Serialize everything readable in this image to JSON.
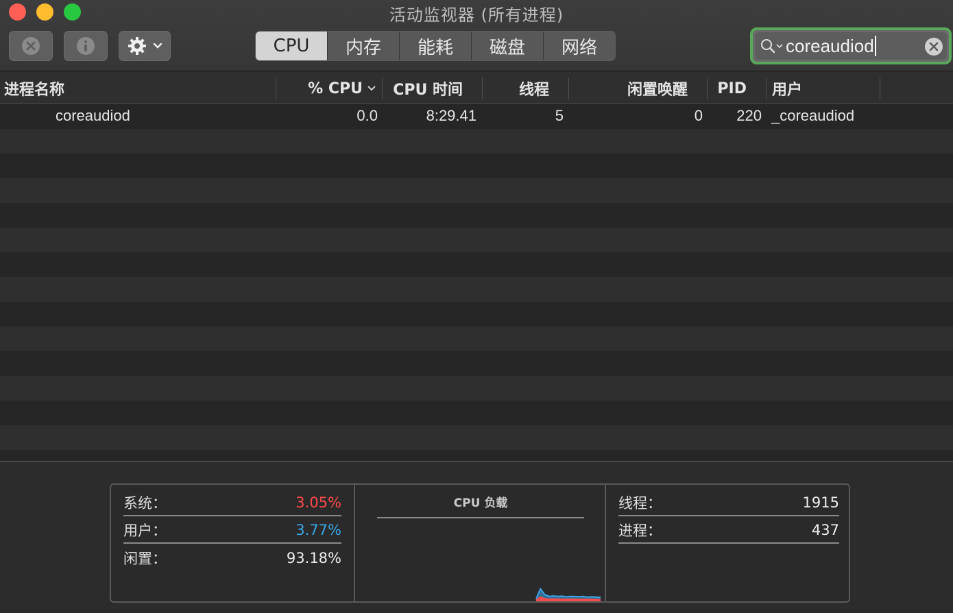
{
  "window": {
    "title": "活动监视器 (所有进程)"
  },
  "toolbar": {
    "tabs": [
      {
        "label": "CPU",
        "active": true
      },
      {
        "label": "内存",
        "active": false
      },
      {
        "label": "能耗",
        "active": false
      },
      {
        "label": "磁盘",
        "active": false
      },
      {
        "label": "网络",
        "active": false
      }
    ],
    "search": {
      "value": "coreaudiod"
    },
    "icons": [
      "stop-process-icon",
      "info-icon",
      "gear-icon",
      "search-icon",
      "clear-icon"
    ]
  },
  "table": {
    "columns": [
      "进程名称",
      "% CPU",
      "CPU 时间",
      "线程",
      "闲置唤醒",
      "PID",
      "用户"
    ],
    "rows": [
      {
        "name": "coreaudiod",
        "cpu": "0.0",
        "cpu_time": "8:29.41",
        "threads": "5",
        "idle_wake": "0",
        "pid": "220",
        "user": "_coreaudiod"
      }
    ]
  },
  "summary": {
    "system": {
      "label": "系统：",
      "value": "3.05%"
    },
    "user": {
      "label": "用户：",
      "value": "3.77%"
    },
    "idle": {
      "label": "闲置：",
      "value": "93.18%"
    },
    "threads": {
      "label": "线程：",
      "value": "1915"
    },
    "processes": {
      "label": "进程：",
      "value": "437"
    }
  },
  "colors": {
    "system": "#ff4a4a",
    "user": "#3aa6ea",
    "search_focus": "#59a85a"
  },
  "chart_data": {
    "type": "area",
    "title": "CPU 负载",
    "x": [
      0,
      1,
      2,
      3,
      4,
      5,
      6,
      7,
      8,
      9,
      10,
      11,
      12,
      13,
      14,
      15
    ],
    "series": [
      {
        "values": [
          0.03,
          0.15,
          0.08,
          0.06,
          0.065,
          0.06,
          0.062,
          0.055,
          0.06,
          0.058,
          0.055,
          0.06,
          0.05,
          0.055,
          0.05,
          0.048
        ]
      },
      {
        "values": [
          0.015,
          0.05,
          0.03,
          0.025,
          0.028,
          0.025,
          0.027,
          0.024,
          0.026,
          0.025,
          0.024,
          0.026,
          0.022,
          0.024,
          0.022,
          0.02
        ]
      }
    ],
    "ylim": [
      0,
      1
    ]
  }
}
